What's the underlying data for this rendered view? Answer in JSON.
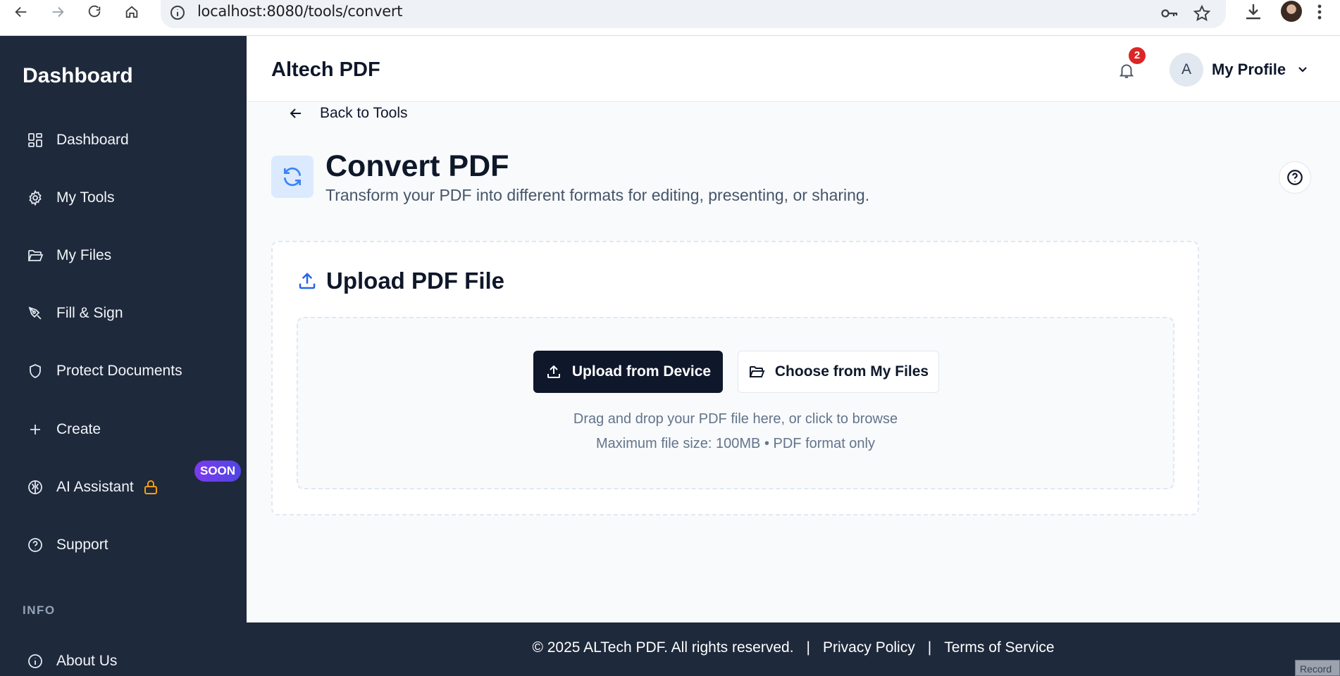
{
  "browser": {
    "url": "localhost:8080/tools/convert"
  },
  "sidebar": {
    "brand": "Dashboard",
    "items": [
      {
        "label": "Dashboard",
        "icon": "grid-icon"
      },
      {
        "label": "My Tools",
        "icon": "gear-icon"
      },
      {
        "label": "My Files",
        "icon": "folder-open-icon"
      },
      {
        "label": "Fill & Sign",
        "icon": "pen-icon"
      },
      {
        "label": "Protect Documents",
        "icon": "shield-icon"
      },
      {
        "label": "Create",
        "icon": "plus-icon"
      },
      {
        "label": "AI Assistant",
        "icon": "brain-icon",
        "badge": "SOON",
        "locked": true
      },
      {
        "label": "Support",
        "icon": "help-circle-icon"
      }
    ],
    "info_label": "INFO",
    "info_items": [
      {
        "label": "About Us",
        "icon": "info-icon"
      }
    ]
  },
  "header": {
    "app_title": "Altech PDF",
    "notification_count": "2",
    "profile_initial": "A",
    "profile_label": "My Profile"
  },
  "main": {
    "back_label": "Back to Tools",
    "title": "Convert PDF",
    "subtitle": "Transform your PDF into different formats for editing, presenting, or sharing.",
    "upload": {
      "heading": "Upload PDF File",
      "primary_button": "Upload from Device",
      "secondary_button": "Choose from My Files",
      "hint": "Drag and drop your PDF file here, or click to browse",
      "limits": "Maximum file size: 100MB • PDF format only"
    }
  },
  "footer": {
    "copyright": "© 2025 ALTech PDF. All rights reserved.",
    "separator": "|",
    "privacy": "Privacy Policy",
    "terms": "Terms of Service"
  },
  "overlay": {
    "record_label": "Record"
  },
  "colors": {
    "sidebar_bg": "#1e293b",
    "primary_button": "#0f172a",
    "accent": "#3b82f6",
    "badge": "#dc2626",
    "soon_gradient_start": "#7c3aed",
    "lock": "#f59e0b"
  }
}
